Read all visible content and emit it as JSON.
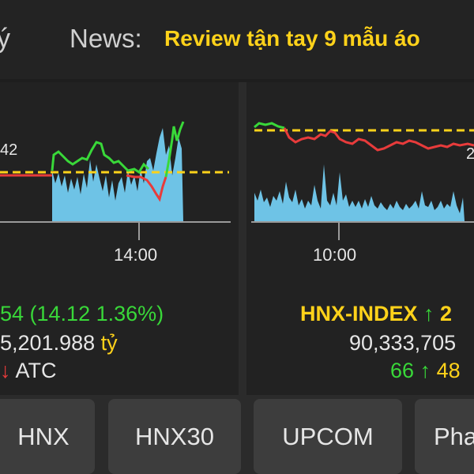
{
  "header": {
    "news_label": "News:",
    "headline": "Review tận tay 9 mẫu áo"
  },
  "left_panel": {
    "price_tag": "42",
    "time_tick": "14:00",
    "change_line": "54  (14.12  1.36%)",
    "value_line": "5,201.988",
    "value_unit": "tỷ",
    "session_status": "ATC",
    "session_arrow": "↓"
  },
  "right_panel": {
    "price_tag": "2",
    "time_tick": "10:00",
    "index_name": "HNX-INDEX",
    "index_arrow": "↑",
    "index_value_partial": "2",
    "volume_line": "90,333,705",
    "advancers": "66",
    "adv_arrow": "↑",
    "decliners_partial": "48"
  },
  "tabs": [
    {
      "label": "HNX"
    },
    {
      "label": "HNX30"
    },
    {
      "label": "UPCOM"
    },
    {
      "label": "Pha"
    }
  ],
  "colors": {
    "up": "#39d839",
    "down": "#e83b3b",
    "reference": "#ffd21a",
    "volume": "#6ec3e6"
  }
}
